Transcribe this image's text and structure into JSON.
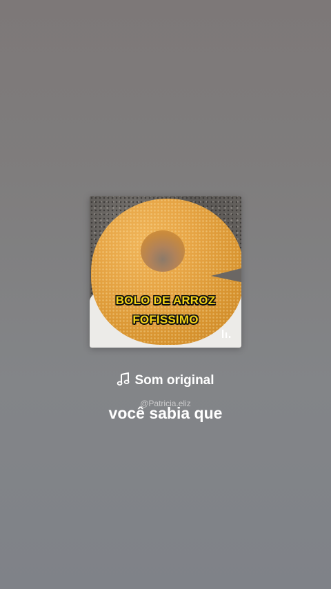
{
  "video": {
    "overlay_line_1": "BOLO DE ARROZ",
    "overlay_line_2": "FOFISSIMO",
    "overlay_text_color": "#f3d318",
    "corner_icon": "bars-icon"
  },
  "audio": {
    "icon": "music-note-icon",
    "label": "Som original"
  },
  "author": "@Patricia.eliz",
  "caption": "você sabia que"
}
